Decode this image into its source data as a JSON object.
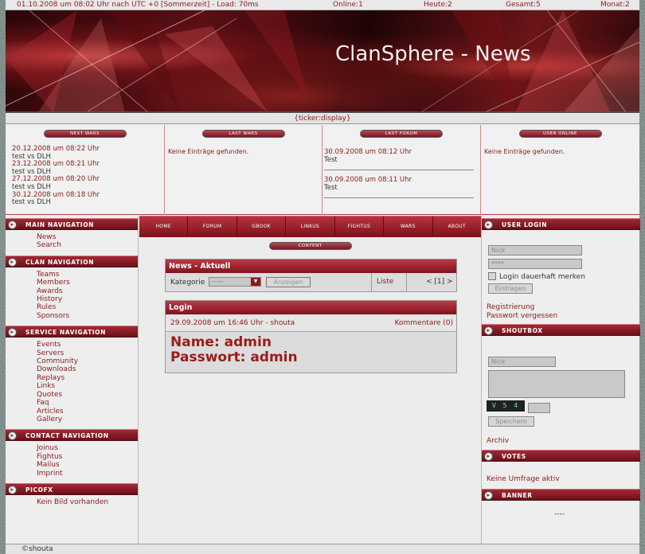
{
  "topbar": {
    "datetime": "01.10.2008 um 08:02 Uhr nach UTC +0 [Sommerzeit] - Load: 70ms",
    "online": "Online:1",
    "today": "Heute:2",
    "total": "Gesamt:5",
    "month": "Monat:2"
  },
  "header": {
    "title": "ClanSphere - News"
  },
  "ticker": "{ticker:display}",
  "panels": {
    "next_wars": {
      "title": "Next Wars",
      "entries": [
        {
          "date": "20.12.2008 um 08:22 Uhr",
          "match": "test vs DLH"
        },
        {
          "date": "23.12.2008 um 08:21 Uhr",
          "match": "test vs DLH"
        },
        {
          "date": "27.12.2008 um 08:20 Uhr",
          "match": "test vs DLH"
        },
        {
          "date": "30.12.2008 um 08:18 Uhr",
          "match": "test vs DLH"
        }
      ]
    },
    "last_wars": {
      "title": "Last Wars",
      "empty": "Keine Einträge gefunden."
    },
    "last_forum": {
      "title": "Last Forum",
      "entries": [
        {
          "date": "30.09.2008 um 08:12 Uhr",
          "topic": "Test"
        },
        {
          "date": "30.09.2008 um 08:11 Uhr",
          "topic": "Test"
        }
      ]
    },
    "user_online": {
      "title": "User Online",
      "empty": "Keine Einträge gefunden."
    }
  },
  "left_nav": [
    {
      "title": "MAIN NAVIGATION",
      "items": [
        "News",
        "Search"
      ]
    },
    {
      "title": "CLAN NAVIGATION",
      "items": [
        "Teams",
        "Members",
        "Awards",
        "History",
        "Rules",
        "Sponsors"
      ]
    },
    {
      "title": "SERVICE NAVIGATION",
      "items": [
        "Events",
        "Servers",
        "Community",
        "Downloads",
        "Replays",
        "Links",
        "Quotes",
        "Faq",
        "Articles",
        "Gallery"
      ]
    },
    {
      "title": "CONTACT NAVIGATION",
      "items": [
        "Joinus",
        "Fightus",
        "Mailus",
        "Imprint"
      ]
    },
    {
      "title": "PICOFX",
      "items": [
        "Kein Bild vorhanden"
      ]
    }
  ],
  "menu": [
    "Home",
    "Forum",
    "Gbook",
    "Linkus",
    "Fightus",
    "Wars",
    "About"
  ],
  "content_label": "Content",
  "news_box": {
    "title": "News - Aktuell",
    "category_label": "Kategorie",
    "category_value": "-----",
    "show_button": "Anzeigen",
    "list_link": "Liste",
    "pagination": "< [1] >"
  },
  "login_box": {
    "title": "Login",
    "meta": "29.09.2008 um 16:46 Uhr - shouta",
    "comments": "Kommentare (0)",
    "line1": "Name: admin",
    "line2": "Passwort: admin"
  },
  "right": {
    "user_login": {
      "title": "USER LOGIN",
      "nick_placeholder": "Nick",
      "password_value": "****",
      "remember_label": "Login dauerhaft merken",
      "submit": "Eintragen",
      "register": "Registrierung",
      "forgot": "Passwort vergessen"
    },
    "shoutbox": {
      "title": "SHOUTBOX",
      "nick_placeholder": "Nick",
      "captcha": "V 5 4",
      "submit": "Speichern",
      "archive": "Archiv"
    },
    "votes": {
      "title": "VOTES",
      "empty": "Keine Umfrage aktiv"
    },
    "banner": {
      "title": "BANNER",
      "value": "----"
    }
  },
  "footer": "©shouta",
  "colors": {
    "accent": "#8b1a1a",
    "header_bar": "#9e2632",
    "page_bg": "#ededed"
  }
}
